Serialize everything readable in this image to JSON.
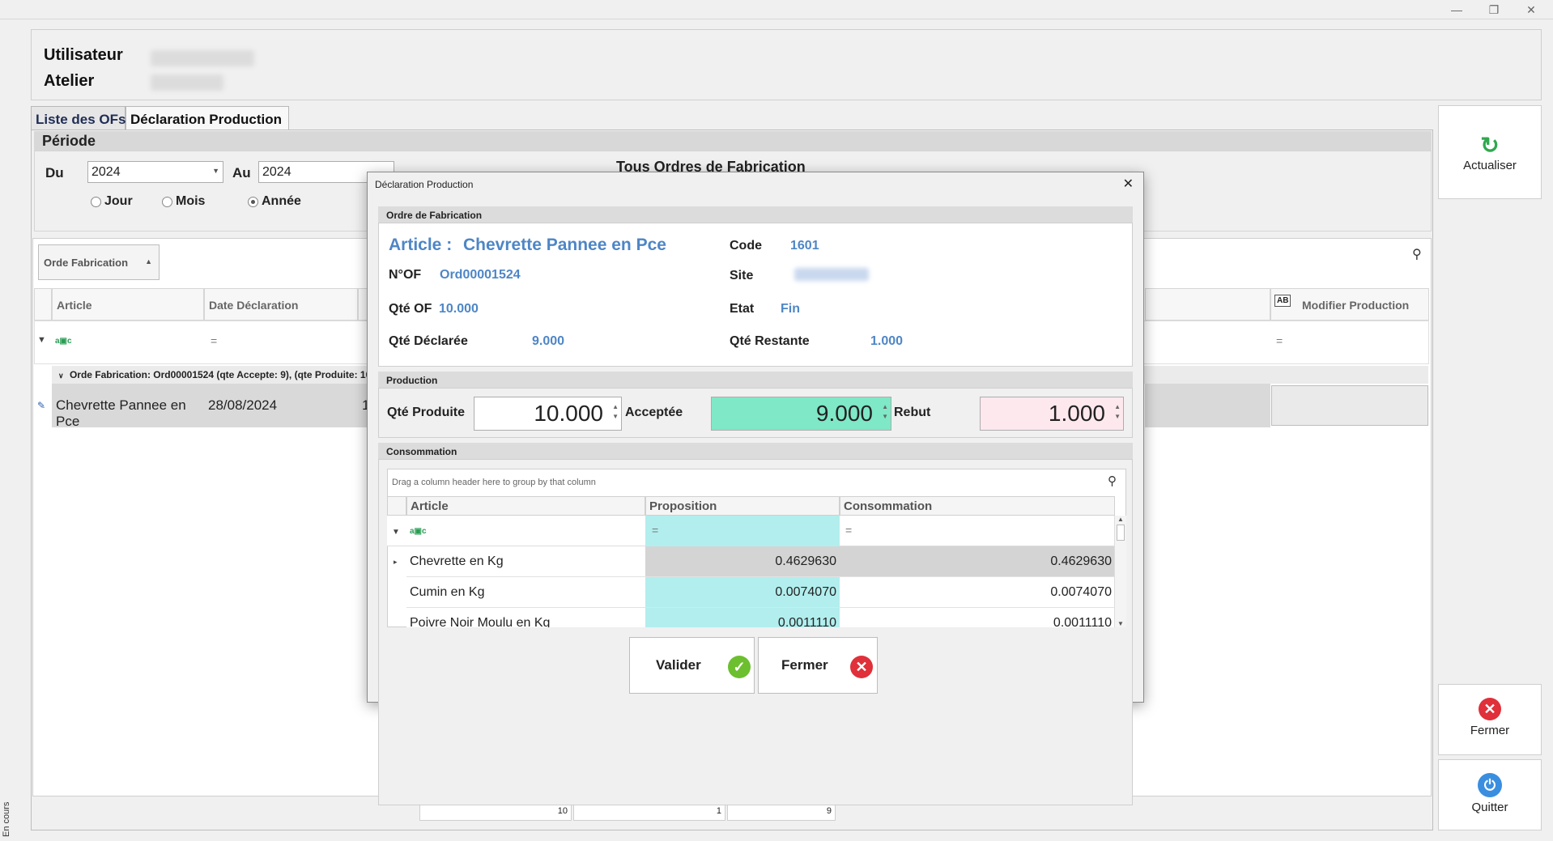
{
  "header": {
    "user_label": "Utilisateur",
    "workshop_label": "Atelier"
  },
  "tabs": [
    {
      "label": "Liste des OFs"
    },
    {
      "label": "Déclaration Production"
    }
  ],
  "period": {
    "title": "Période",
    "from_label": "Du",
    "from_value": "2024",
    "to_label": "Au",
    "to_value": "2024",
    "radio_day": "Jour",
    "radio_month": "Mois",
    "radio_year": "Année",
    "selected": "Année",
    "all_orders": "Tous Ordres de Fabrication"
  },
  "grid": {
    "group_button": "Orde Fabrication",
    "columns": {
      "article": "Article",
      "date": "Date Déclaration",
      "modify": "Modifier Production"
    },
    "filter_eq": "=",
    "group_row": "Orde Fabrication: Ord00001524 (qte Accepte: 9), (qte Produite: 10",
    "row": {
      "article": "Chevrette Pannee en Pce",
      "date": "28/08/2024",
      "partial": "1"
    },
    "footer": [
      "10",
      "1",
      "9"
    ]
  },
  "right_buttons": {
    "refresh": "Actualiser",
    "close": "Fermer",
    "quit": "Quitter"
  },
  "status_vertical": "En cours",
  "modal": {
    "title": "Déclaration Production",
    "order_section": "Ordre de Fabrication",
    "article_label": "Article :",
    "article_value": "Chevrette Pannee en Pce",
    "code_label": "Code",
    "code_value": "1601",
    "nof_label": "N°OF",
    "nof_value": "Ord00001524",
    "site_label": "Site",
    "qte_of_label": "Qté OF",
    "qte_of_value": "10.000",
    "etat_label": "Etat",
    "etat_value": "Fin",
    "qte_declaree_label": "Qté Déclarée",
    "qte_declaree_value": "9.000",
    "qte_restante_label": "Qté Restante",
    "qte_restante_value": "1.000",
    "production_section": "Production",
    "qte_produite_label": "Qté Produite",
    "qte_produite_value": "10.000",
    "acceptee_label": "Acceptée",
    "acceptee_value": "9.000",
    "rebut_label": "Rebut",
    "rebut_value": "1.000",
    "consommation_section": "Consommation",
    "drag_hint": "Drag a column header here to group by that column",
    "cons_columns": {
      "article": "Article",
      "proposition": "Proposition",
      "consommation": "Consommation"
    },
    "cons_rows": [
      {
        "article": "Chevrette en Kg",
        "proposition": "0.4629630",
        "consommation": "0.4629630"
      },
      {
        "article": "Cumin en Kg",
        "proposition": "0.0074070",
        "consommation": "0.0074070"
      },
      {
        "article": "Poivre Noir Moulu en Kg",
        "proposition": "0.0011110",
        "consommation": "0.0011110"
      }
    ],
    "validate_button": "Valider",
    "close_button": "Fermer",
    "colors": {
      "accent_blue": "#4e86c6",
      "accepted_bg": "#7fe8c6",
      "rebut_bg": "#fde8ee",
      "proposition_bg": "#b2eeee"
    }
  }
}
